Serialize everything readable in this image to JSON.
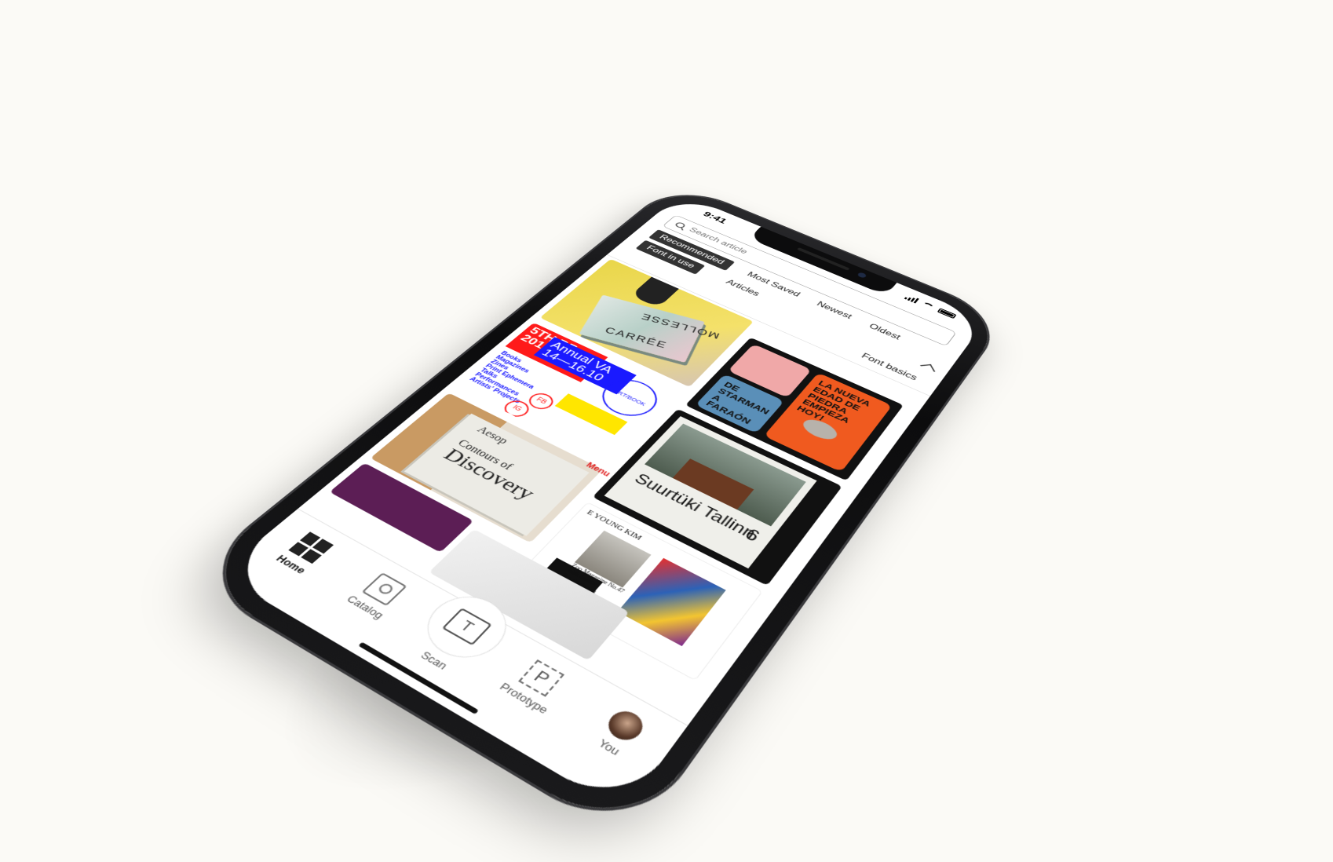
{
  "status": {
    "time": "9:41"
  },
  "search": {
    "placeholder": "Search article"
  },
  "sort_tabs": [
    {
      "label": "Recommended",
      "active": true
    },
    {
      "label": "Most Saved",
      "active": false
    },
    {
      "label": "Newest",
      "active": false
    },
    {
      "label": "Oldest",
      "active": false
    }
  ],
  "category_tabs": [
    {
      "label": "Font in use",
      "active": true
    },
    {
      "label": "Articles",
      "active": false
    },
    {
      "label": "Font basics",
      "active": false
    }
  ],
  "cards": {
    "molesse": {
      "line1": "MOLLESSE",
      "line2": "CARRÉE"
    },
    "phones": {
      "p1": "",
      "p2": "LA NUEVA EDAD DE PIEDRA EMPIEZA HOY!",
      "p3": "DE STARMAN A FARAÓN"
    },
    "artbook": {
      "red": "5TH BF 2016!!!",
      "blue": "Annual VA 14—16.10",
      "list": [
        "Books",
        "Magazines",
        "Zines",
        "Print Ephemera",
        "Talks",
        "Performances",
        "Artists' Projects"
      ],
      "ring": "ART/BOOK FAIR VANCOUVER",
      "fb": "FB",
      "ig": "IG"
    },
    "tallinn": {
      "title": "Suurtüki Tallinn",
      "number": "6"
    },
    "aesop": {
      "brand": "Aesop",
      "line1": "Contours of",
      "line2": "Discovery"
    },
    "menu_tag": "Menu",
    "zoo": {
      "header": "E YOUNG KIM",
      "caption": "Zoo Magazine No.47 with Janelle Hoogenboom"
    }
  },
  "tabbar": [
    {
      "label": "Home",
      "icon": "home-grid-icon",
      "active": true
    },
    {
      "label": "Catalog",
      "icon": "catalog-book-icon",
      "active": false
    },
    {
      "label": "Scan",
      "icon": "scan-text-icon",
      "active": false
    },
    {
      "label": "Prototype",
      "icon": "prototype-p-icon",
      "active": false
    },
    {
      "label": "You",
      "icon": "avatar-icon",
      "active": false
    }
  ],
  "colors": {
    "background": "#fbfaf6",
    "active_tab": "#333333",
    "accent_red": "#ff1a1a",
    "accent_blue": "#1a1aff"
  }
}
